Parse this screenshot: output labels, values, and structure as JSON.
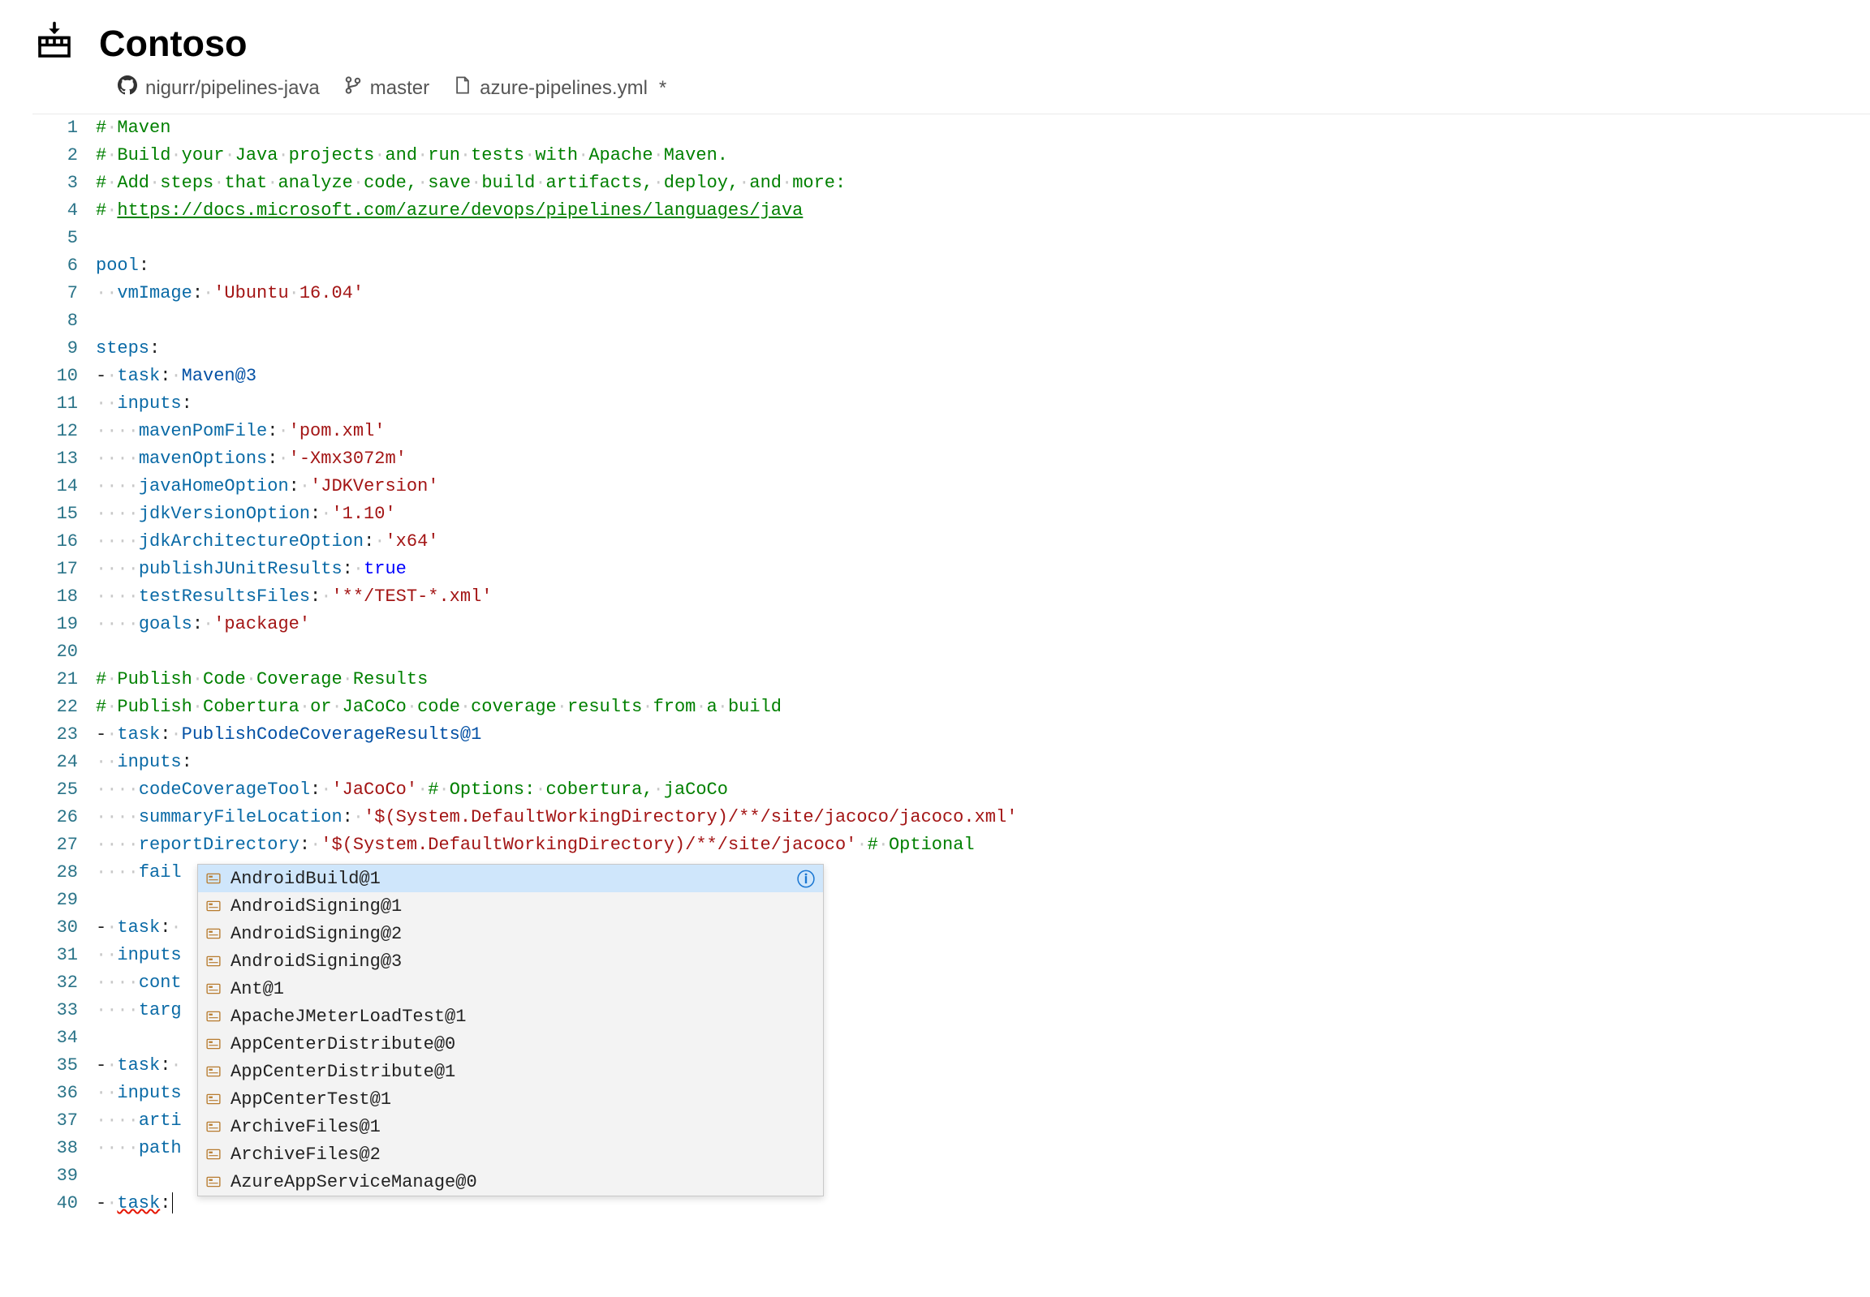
{
  "header": {
    "org_name": "Contoso"
  },
  "breadcrumb": {
    "repo": "nigurr/pipelines-java",
    "branch": "master",
    "file": "azure-pipelines.yml",
    "dirty": "*"
  },
  "editor": {
    "line_count": 40,
    "lines": [
      {
        "n": 1,
        "segs": [
          {
            "t": "#",
            "c": "tok-comment"
          },
          {
            "t": "·",
            "c": "dot"
          },
          {
            "t": "Maven",
            "c": "tok-comment"
          }
        ]
      },
      {
        "n": 2,
        "segs": [
          {
            "t": "#",
            "c": "tok-comment"
          },
          {
            "t": "·",
            "c": "dot"
          },
          {
            "t": "Build",
            "c": "tok-comment"
          },
          {
            "t": "·",
            "c": "dot"
          },
          {
            "t": "your",
            "c": "tok-comment"
          },
          {
            "t": "·",
            "c": "dot"
          },
          {
            "t": "Java",
            "c": "tok-comment"
          },
          {
            "t": "·",
            "c": "dot"
          },
          {
            "t": "projects",
            "c": "tok-comment"
          },
          {
            "t": "·",
            "c": "dot"
          },
          {
            "t": "and",
            "c": "tok-comment"
          },
          {
            "t": "·",
            "c": "dot"
          },
          {
            "t": "run",
            "c": "tok-comment"
          },
          {
            "t": "·",
            "c": "dot"
          },
          {
            "t": "tests",
            "c": "tok-comment"
          },
          {
            "t": "·",
            "c": "dot"
          },
          {
            "t": "with",
            "c": "tok-comment"
          },
          {
            "t": "·",
            "c": "dot"
          },
          {
            "t": "Apache",
            "c": "tok-comment"
          },
          {
            "t": "·",
            "c": "dot"
          },
          {
            "t": "Maven.",
            "c": "tok-comment"
          }
        ]
      },
      {
        "n": 3,
        "segs": [
          {
            "t": "#",
            "c": "tok-comment"
          },
          {
            "t": "·",
            "c": "dot"
          },
          {
            "t": "Add",
            "c": "tok-comment"
          },
          {
            "t": "·",
            "c": "dot"
          },
          {
            "t": "steps",
            "c": "tok-comment"
          },
          {
            "t": "·",
            "c": "dot"
          },
          {
            "t": "that",
            "c": "tok-comment"
          },
          {
            "t": "·",
            "c": "dot"
          },
          {
            "t": "analyze",
            "c": "tok-comment"
          },
          {
            "t": "·",
            "c": "dot"
          },
          {
            "t": "code,",
            "c": "tok-comment"
          },
          {
            "t": "·",
            "c": "dot"
          },
          {
            "t": "save",
            "c": "tok-comment"
          },
          {
            "t": "·",
            "c": "dot"
          },
          {
            "t": "build",
            "c": "tok-comment"
          },
          {
            "t": "·",
            "c": "dot"
          },
          {
            "t": "artifacts,",
            "c": "tok-comment"
          },
          {
            "t": "·",
            "c": "dot"
          },
          {
            "t": "deploy,",
            "c": "tok-comment"
          },
          {
            "t": "·",
            "c": "dot"
          },
          {
            "t": "and",
            "c": "tok-comment"
          },
          {
            "t": "·",
            "c": "dot"
          },
          {
            "t": "more:",
            "c": "tok-comment"
          }
        ]
      },
      {
        "n": 4,
        "segs": [
          {
            "t": "#",
            "c": "tok-comment"
          },
          {
            "t": "·",
            "c": "dot"
          },
          {
            "t": "https://docs.microsoft.com/azure/devops/pipelines/languages/java",
            "c": "tok-link"
          }
        ]
      },
      {
        "n": 5,
        "segs": []
      },
      {
        "n": 6,
        "segs": [
          {
            "t": "pool",
            "c": "tok-key"
          },
          {
            "t": ":",
            "c": "tok-colon"
          }
        ]
      },
      {
        "n": 7,
        "segs": [
          {
            "t": "··",
            "c": "dot"
          },
          {
            "t": "vmImage",
            "c": "tok-key"
          },
          {
            "t": ":",
            "c": "tok-colon"
          },
          {
            "t": "·",
            "c": "dot"
          },
          {
            "t": "'Ubuntu",
            "c": "tok-string"
          },
          {
            "t": "·",
            "c": "dot"
          },
          {
            "t": "16.04'",
            "c": "tok-string"
          }
        ]
      },
      {
        "n": 8,
        "segs": []
      },
      {
        "n": 9,
        "segs": [
          {
            "t": "steps",
            "c": "tok-key"
          },
          {
            "t": ":",
            "c": "tok-colon"
          }
        ]
      },
      {
        "n": 10,
        "segs": [
          {
            "t": "-",
            "c": "tok-dash"
          },
          {
            "t": "·",
            "c": "dot"
          },
          {
            "t": "task",
            "c": "tok-key"
          },
          {
            "t": ":",
            "c": "tok-colon"
          },
          {
            "t": "·",
            "c": "dot"
          },
          {
            "t": "Maven@3",
            "c": "tok-value"
          }
        ]
      },
      {
        "n": 11,
        "segs": [
          {
            "t": "··",
            "c": "dot"
          },
          {
            "t": "inputs",
            "c": "tok-key"
          },
          {
            "t": ":",
            "c": "tok-colon"
          }
        ]
      },
      {
        "n": 12,
        "segs": [
          {
            "t": "····",
            "c": "dot"
          },
          {
            "t": "mavenPomFile",
            "c": "tok-key"
          },
          {
            "t": ":",
            "c": "tok-colon"
          },
          {
            "t": "·",
            "c": "dot"
          },
          {
            "t": "'pom.xml'",
            "c": "tok-string"
          }
        ]
      },
      {
        "n": 13,
        "segs": [
          {
            "t": "····",
            "c": "dot"
          },
          {
            "t": "mavenOptions",
            "c": "tok-key"
          },
          {
            "t": ":",
            "c": "tok-colon"
          },
          {
            "t": "·",
            "c": "dot"
          },
          {
            "t": "'-Xmx3072m'",
            "c": "tok-string"
          }
        ]
      },
      {
        "n": 14,
        "segs": [
          {
            "t": "····",
            "c": "dot"
          },
          {
            "t": "javaHomeOption",
            "c": "tok-key"
          },
          {
            "t": ":",
            "c": "tok-colon"
          },
          {
            "t": "·",
            "c": "dot"
          },
          {
            "t": "'JDKVersion'",
            "c": "tok-string"
          }
        ]
      },
      {
        "n": 15,
        "segs": [
          {
            "t": "····",
            "c": "dot"
          },
          {
            "t": "jdkVersionOption",
            "c": "tok-key"
          },
          {
            "t": ":",
            "c": "tok-colon"
          },
          {
            "t": "·",
            "c": "dot"
          },
          {
            "t": "'1.10'",
            "c": "tok-string"
          }
        ]
      },
      {
        "n": 16,
        "segs": [
          {
            "t": "····",
            "c": "dot"
          },
          {
            "t": "jdkArchitectureOption",
            "c": "tok-key"
          },
          {
            "t": ":",
            "c": "tok-colon"
          },
          {
            "t": "·",
            "c": "dot"
          },
          {
            "t": "'x64'",
            "c": "tok-string"
          }
        ]
      },
      {
        "n": 17,
        "segs": [
          {
            "t": "····",
            "c": "dot"
          },
          {
            "t": "publishJUnitResults",
            "c": "tok-key"
          },
          {
            "t": ":",
            "c": "tok-colon"
          },
          {
            "t": "·",
            "c": "dot"
          },
          {
            "t": "true",
            "c": "tok-bool"
          }
        ]
      },
      {
        "n": 18,
        "segs": [
          {
            "t": "····",
            "c": "dot"
          },
          {
            "t": "testResultsFiles",
            "c": "tok-key"
          },
          {
            "t": ":",
            "c": "tok-colon"
          },
          {
            "t": "·",
            "c": "dot"
          },
          {
            "t": "'**/TEST-*.xml'",
            "c": "tok-string"
          }
        ]
      },
      {
        "n": 19,
        "segs": [
          {
            "t": "····",
            "c": "dot"
          },
          {
            "t": "goals",
            "c": "tok-key"
          },
          {
            "t": ":",
            "c": "tok-colon"
          },
          {
            "t": "·",
            "c": "dot"
          },
          {
            "t": "'package'",
            "c": "tok-string"
          }
        ]
      },
      {
        "n": 20,
        "segs": []
      },
      {
        "n": 21,
        "segs": [
          {
            "t": "#",
            "c": "tok-comment"
          },
          {
            "t": "·",
            "c": "dot"
          },
          {
            "t": "Publish",
            "c": "tok-comment"
          },
          {
            "t": "·",
            "c": "dot"
          },
          {
            "t": "Code",
            "c": "tok-comment"
          },
          {
            "t": "·",
            "c": "dot"
          },
          {
            "t": "Coverage",
            "c": "tok-comment"
          },
          {
            "t": "·",
            "c": "dot"
          },
          {
            "t": "Results",
            "c": "tok-comment"
          }
        ]
      },
      {
        "n": 22,
        "segs": [
          {
            "t": "#",
            "c": "tok-comment"
          },
          {
            "t": "·",
            "c": "dot"
          },
          {
            "t": "Publish",
            "c": "tok-comment"
          },
          {
            "t": "·",
            "c": "dot"
          },
          {
            "t": "Cobertura",
            "c": "tok-comment"
          },
          {
            "t": "·",
            "c": "dot"
          },
          {
            "t": "or",
            "c": "tok-comment"
          },
          {
            "t": "·",
            "c": "dot"
          },
          {
            "t": "JaCoCo",
            "c": "tok-comment"
          },
          {
            "t": "·",
            "c": "dot"
          },
          {
            "t": "code",
            "c": "tok-comment"
          },
          {
            "t": "·",
            "c": "dot"
          },
          {
            "t": "coverage",
            "c": "tok-comment"
          },
          {
            "t": "·",
            "c": "dot"
          },
          {
            "t": "results",
            "c": "tok-comment"
          },
          {
            "t": "·",
            "c": "dot"
          },
          {
            "t": "from",
            "c": "tok-comment"
          },
          {
            "t": "·",
            "c": "dot"
          },
          {
            "t": "a",
            "c": "tok-comment"
          },
          {
            "t": "·",
            "c": "dot"
          },
          {
            "t": "build",
            "c": "tok-comment"
          }
        ]
      },
      {
        "n": 23,
        "segs": [
          {
            "t": "-",
            "c": "tok-dash"
          },
          {
            "t": "·",
            "c": "dot"
          },
          {
            "t": "task",
            "c": "tok-key"
          },
          {
            "t": ":",
            "c": "tok-colon"
          },
          {
            "t": "·",
            "c": "dot"
          },
          {
            "t": "PublishCodeCoverageResults@1",
            "c": "tok-value"
          }
        ]
      },
      {
        "n": 24,
        "segs": [
          {
            "t": "··",
            "c": "dot"
          },
          {
            "t": "inputs",
            "c": "tok-key"
          },
          {
            "t": ":",
            "c": "tok-colon"
          }
        ]
      },
      {
        "n": 25,
        "segs": [
          {
            "t": "····",
            "c": "dot"
          },
          {
            "t": "codeCoverageTool",
            "c": "tok-key"
          },
          {
            "t": ":",
            "c": "tok-colon"
          },
          {
            "t": "·",
            "c": "dot"
          },
          {
            "t": "'JaCoCo'",
            "c": "tok-string"
          },
          {
            "t": "·",
            "c": "dot"
          },
          {
            "t": "#",
            "c": "tok-comment"
          },
          {
            "t": "·",
            "c": "dot"
          },
          {
            "t": "Options:",
            "c": "tok-comment"
          },
          {
            "t": "·",
            "c": "dot"
          },
          {
            "t": "cobertura,",
            "c": "tok-comment"
          },
          {
            "t": "·",
            "c": "dot"
          },
          {
            "t": "jaCoCo",
            "c": "tok-comment"
          }
        ]
      },
      {
        "n": 26,
        "segs": [
          {
            "t": "····",
            "c": "dot"
          },
          {
            "t": "summaryFileLocation",
            "c": "tok-key"
          },
          {
            "t": ":",
            "c": "tok-colon"
          },
          {
            "t": "·",
            "c": "dot"
          },
          {
            "t": "'$(System.DefaultWorkingDirectory)/**/site/jacoco/jacoco.xml'",
            "c": "tok-string"
          }
        ]
      },
      {
        "n": 27,
        "segs": [
          {
            "t": "····",
            "c": "dot"
          },
          {
            "t": "reportDirectory",
            "c": "tok-key"
          },
          {
            "t": ":",
            "c": "tok-colon"
          },
          {
            "t": "·",
            "c": "dot"
          },
          {
            "t": "'$(System.DefaultWorkingDirectory)/**/site/jacoco'",
            "c": "tok-string"
          },
          {
            "t": "·",
            "c": "dot"
          },
          {
            "t": "#",
            "c": "tok-comment"
          },
          {
            "t": "·",
            "c": "dot"
          },
          {
            "t": "Optional",
            "c": "tok-comment"
          }
        ]
      },
      {
        "n": 28,
        "segs": [
          {
            "t": "····",
            "c": "dot"
          },
          {
            "t": "fail",
            "c": "tok-key"
          }
        ]
      },
      {
        "n": 29,
        "segs": []
      },
      {
        "n": 30,
        "segs": [
          {
            "t": "-",
            "c": "tok-dash"
          },
          {
            "t": "·",
            "c": "dot"
          },
          {
            "t": "task",
            "c": "tok-key"
          },
          {
            "t": ":",
            "c": "tok-colon"
          },
          {
            "t": "·",
            "c": "dot"
          }
        ]
      },
      {
        "n": 31,
        "segs": [
          {
            "t": "··",
            "c": "dot"
          },
          {
            "t": "inputs",
            "c": "tok-key"
          }
        ]
      },
      {
        "n": 32,
        "segs": [
          {
            "t": "····",
            "c": "dot"
          },
          {
            "t": "cont",
            "c": "tok-key"
          }
        ]
      },
      {
        "n": 33,
        "segs": [
          {
            "t": "····",
            "c": "dot"
          },
          {
            "t": "targ",
            "c": "tok-key"
          }
        ]
      },
      {
        "n": 34,
        "segs": []
      },
      {
        "n": 35,
        "segs": [
          {
            "t": "-",
            "c": "tok-dash"
          },
          {
            "t": "·",
            "c": "dot"
          },
          {
            "t": "task",
            "c": "tok-key"
          },
          {
            "t": ":",
            "c": "tok-colon"
          },
          {
            "t": "·",
            "c": "dot"
          }
        ]
      },
      {
        "n": 36,
        "segs": [
          {
            "t": "··",
            "c": "dot"
          },
          {
            "t": "inputs",
            "c": "tok-key"
          }
        ]
      },
      {
        "n": 37,
        "segs": [
          {
            "t": "····",
            "c": "dot"
          },
          {
            "t": "arti",
            "c": "tok-key"
          }
        ]
      },
      {
        "n": 38,
        "segs": [
          {
            "t": "····",
            "c": "dot"
          },
          {
            "t": "path",
            "c": "tok-key"
          }
        ]
      },
      {
        "n": 39,
        "segs": []
      },
      {
        "n": 40,
        "segs": [
          {
            "t": "-",
            "c": "tok-dash"
          },
          {
            "t": "·",
            "c": "dot"
          },
          {
            "t": "task",
            "c": "tok-key squiggle"
          },
          {
            "t": ":",
            "c": "tok-colon"
          }
        ],
        "cursor": true
      }
    ]
  },
  "suggest": {
    "selected_index": 0,
    "items": [
      "AndroidBuild@1",
      "AndroidSigning@1",
      "AndroidSigning@2",
      "AndroidSigning@3",
      "Ant@1",
      "ApacheJMeterLoadTest@1",
      "AppCenterDistribute@0",
      "AppCenterDistribute@1",
      "AppCenterTest@1",
      "ArchiveFiles@1",
      "ArchiveFiles@2",
      "AzureAppServiceManage@0"
    ]
  }
}
